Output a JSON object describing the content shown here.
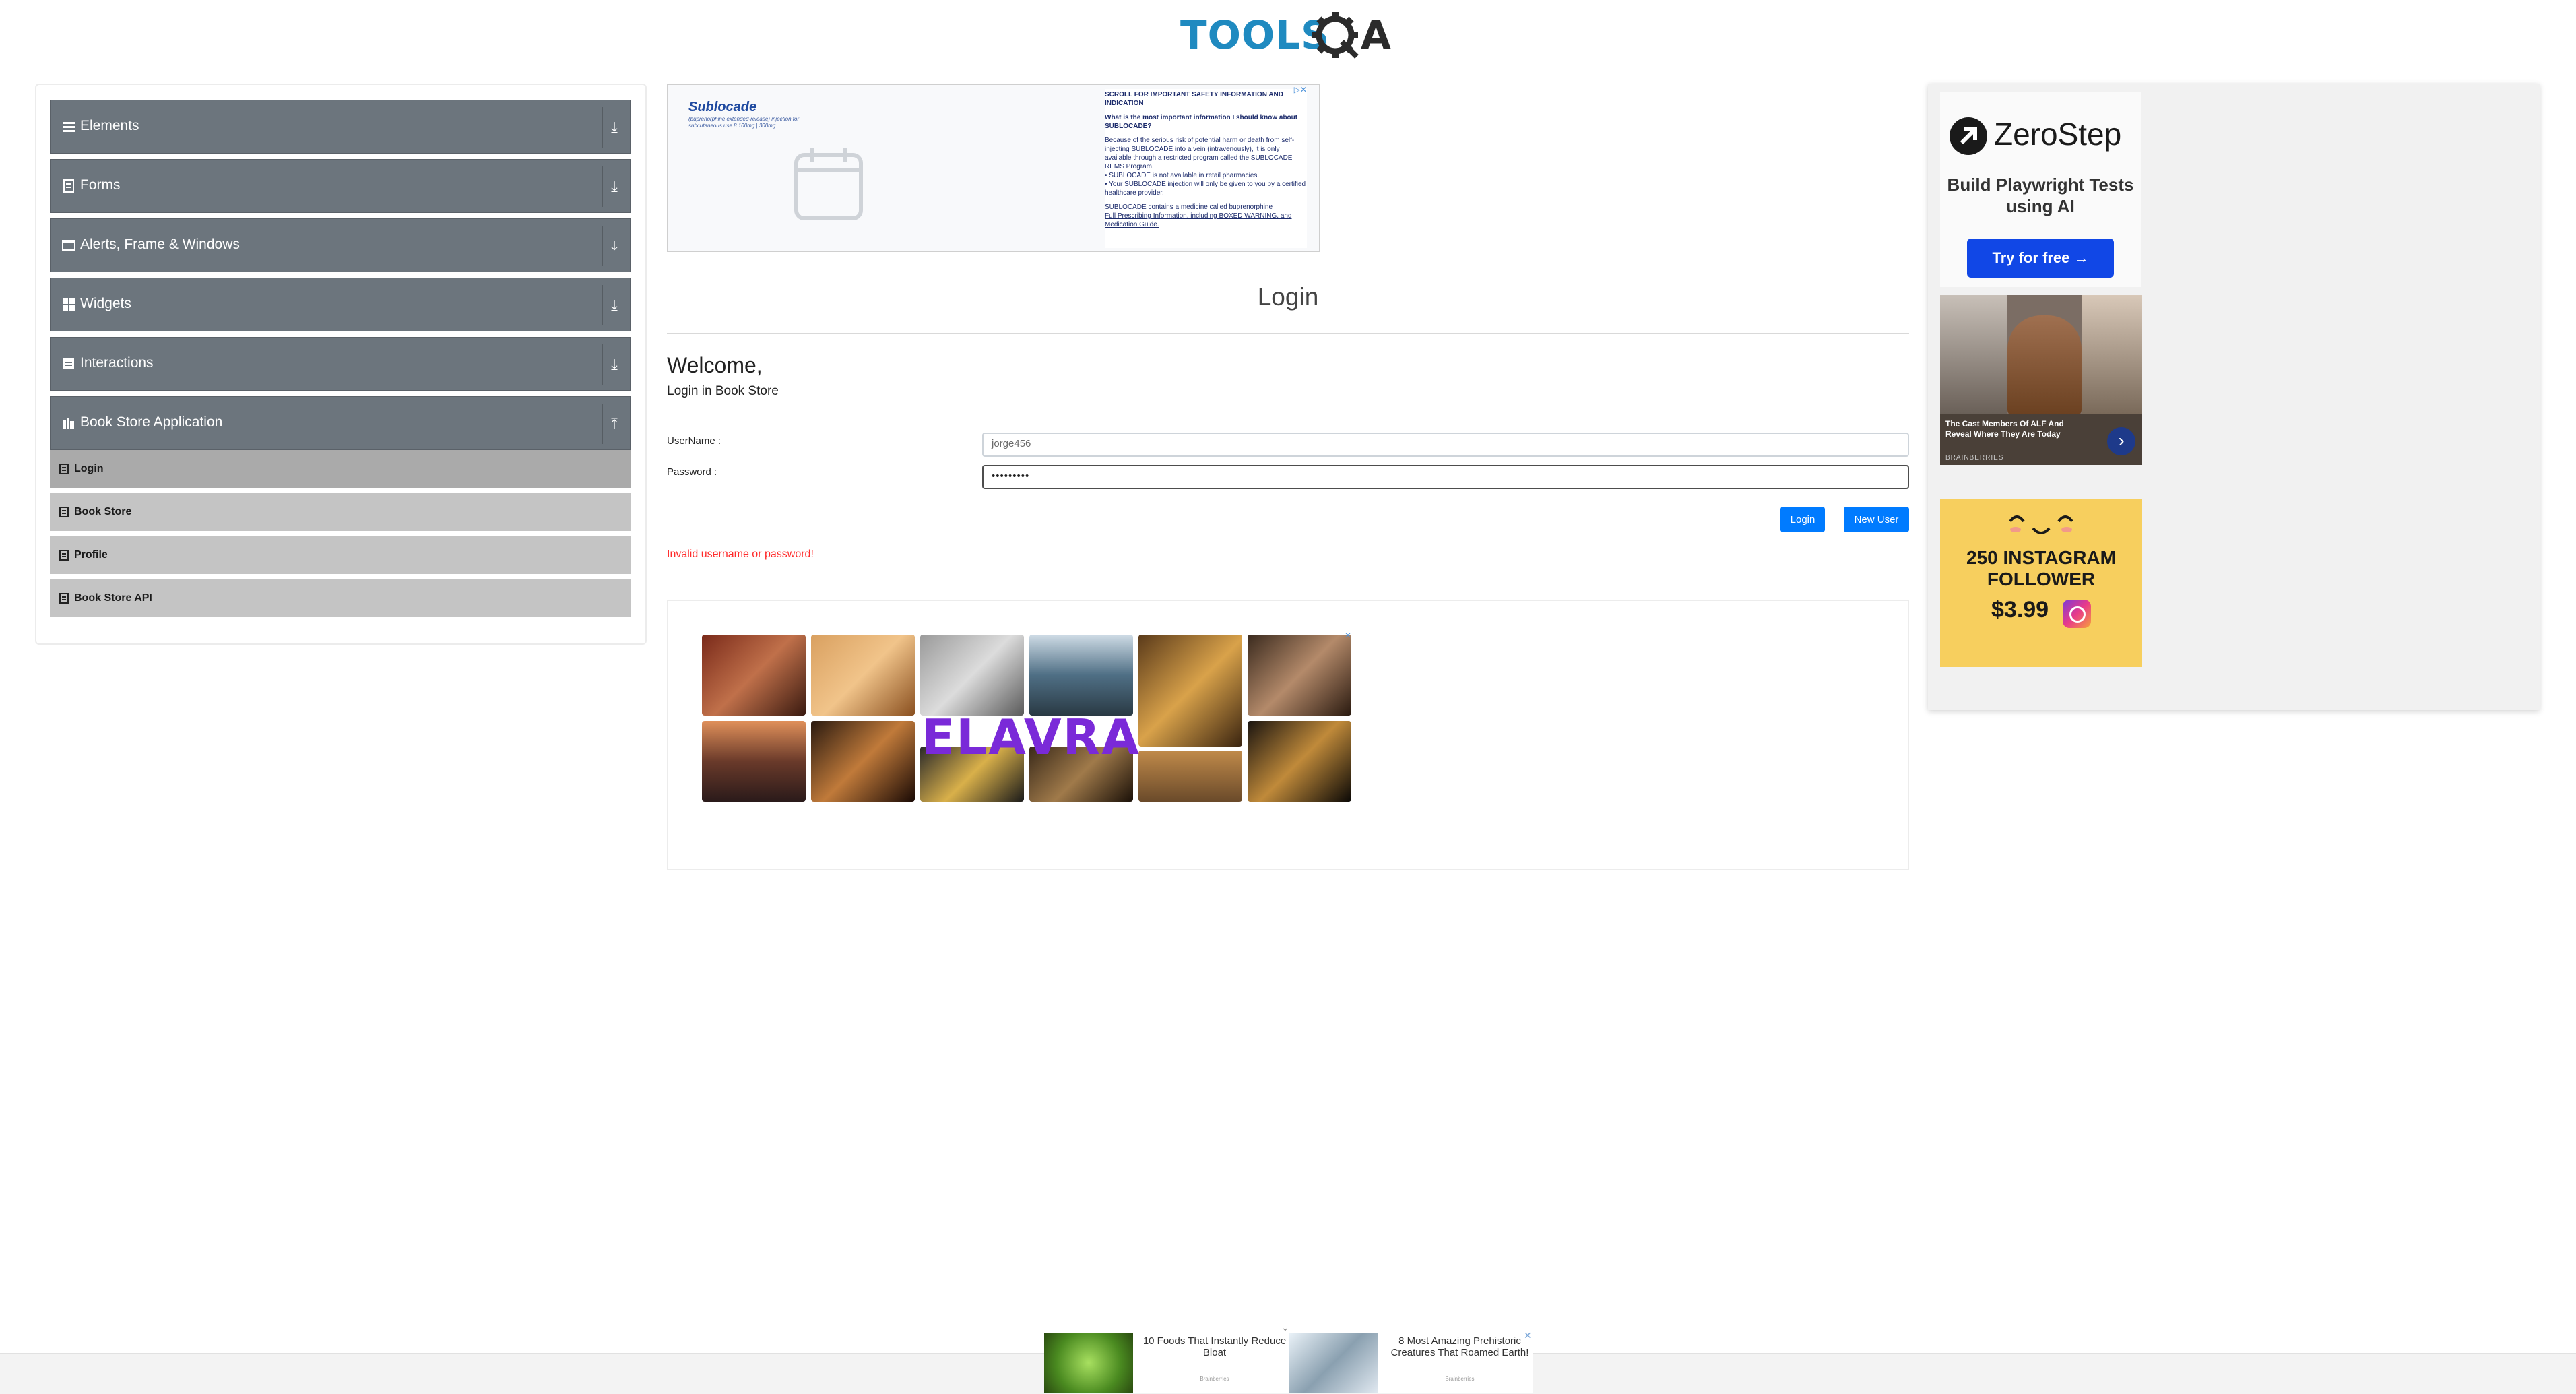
{
  "header": {
    "logo_text_a": "TOOLS",
    "logo_text_b": "A"
  },
  "sidebar": {
    "groups": [
      {
        "label": "Elements",
        "icon": "hamburger-icon"
      },
      {
        "label": "Forms",
        "icon": "form-icon"
      },
      {
        "label": "Alerts, Frame & Windows",
        "icon": "window-icon"
      },
      {
        "label": "Widgets",
        "icon": "grid-icon"
      },
      {
        "label": "Interactions",
        "icon": "interaction-icon"
      },
      {
        "label": "Book Store Application",
        "icon": "book-icon"
      }
    ],
    "book_store_items": [
      {
        "label": "Login"
      },
      {
        "label": "Book Store"
      },
      {
        "label": "Profile"
      },
      {
        "label": "Book Store API"
      }
    ]
  },
  "ads": {
    "top": {
      "brand": "Sublocade",
      "brand_sub": "(buprenorphine extended-release) injection for subcutaneous use 8 100mg | 300mg",
      "heading": "SCROLL FOR IMPORTANT SAFETY INFORMATION AND INDICATION",
      "q": "What is the most important information I should know about SUBLOCADE?",
      "p1": "Because of the serious risk of potential harm or death from self-injecting SUBLOCADE into a vein (intravenously), it is only available through a restricted program called the SUBLOCADE REMS Program.",
      "b1": "• SUBLOCADE is not available in retail pharmacies.",
      "b2": "• Your SUBLOCADE injection will only be given to you by a certified healthcare provider.",
      "p2": "SUBLOCADE contains a medicine called buprenorphine",
      "p3": "Full Prescribing Information, including BOXED WARNING, and Medication Guide."
    },
    "mid_brand": "ELAVRA",
    "zerostep": {
      "brand": "ZeroStep",
      "tagline": "Build Playwright Tests using AI",
      "cta": "Try for free →"
    },
    "alf": {
      "caption": "The Cast Members Of ALF And Reveal Where They Are Today",
      "source": "BRAINBERRIES"
    },
    "instagram": {
      "line1": "250 INSTAGRAM",
      "line2": "FOLLOWER",
      "price": "$3.99"
    },
    "bottom": [
      {
        "text": "10 Foods That Instantly Reduce Bloat",
        "source": "Brainberries"
      },
      {
        "text": "8 Most Amazing Prehistoric Creatures That Roamed Earth!",
        "source": "Brainberries"
      }
    ]
  },
  "main": {
    "title": "Login",
    "welcome": "Welcome,",
    "subtitle": "Login in Book Store",
    "username_label": "UserName :",
    "username_value": "jorge456",
    "password_label": "Password :",
    "password_value": "•••••••••",
    "login_button": "Login",
    "new_user_button": "New User",
    "error": "Invalid username or password!"
  },
  "colors": {
    "accent": "#007bff",
    "sidebar_group": "#6c757d",
    "sidebar_item": "#c4c4c4",
    "error": "#ff2b2b"
  }
}
